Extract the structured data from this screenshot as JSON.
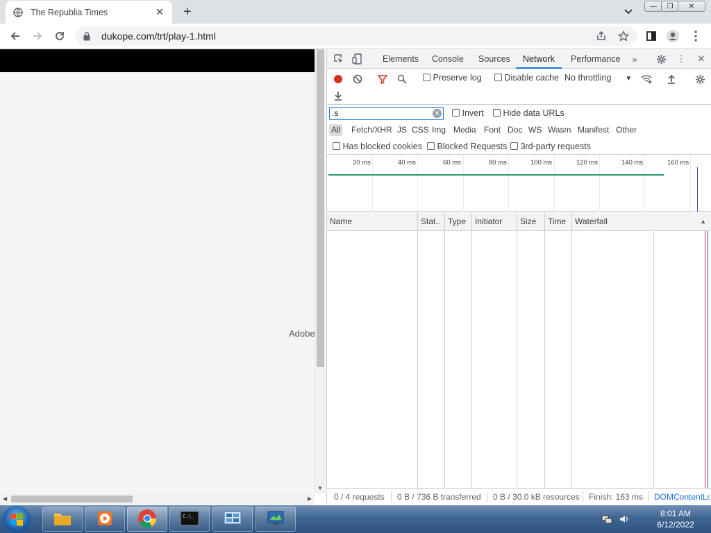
{
  "browser": {
    "tab_title": "The Republia Times",
    "url": "dukope.com/trt/play-1.html"
  },
  "page": {
    "adobe_text": "Adobe"
  },
  "devtools": {
    "tabs": [
      "Elements",
      "Console",
      "Sources",
      "Network",
      "Performance"
    ],
    "active_tab": "Network",
    "toolbar": {
      "preserve_log": "Preserve log",
      "disable_cache": "Disable cache",
      "throttling": "No throttling"
    },
    "filter": {
      "value": ".s",
      "invert": "Invert",
      "hide_data_urls": "Hide data URLs"
    },
    "types": [
      "All",
      "Fetch/XHR",
      "JS",
      "CSS",
      "Img",
      "Media",
      "Font",
      "Doc",
      "WS",
      "Wasm",
      "Manifest",
      "Other"
    ],
    "active_type": "All",
    "blocked": {
      "has_blocked_cookies": "Has blocked cookies",
      "blocked_requests": "Blocked Requests",
      "third_party": "3rd-party requests"
    },
    "overview_ticks": [
      "20 ms",
      "40 ms",
      "60 ms",
      "80 ms",
      "100 ms",
      "120 ms",
      "140 ms",
      "160 ms"
    ],
    "columns": [
      "Name",
      "Stat..",
      "Type",
      "Initiator",
      "Size",
      "Time",
      "Waterfall"
    ],
    "status": {
      "requests": "0 / 4 requests",
      "transferred": "0 B / 736 B transferred",
      "resources": "0 B / 30.0 kB resources",
      "finish": "Finish: 163 ms",
      "domcontent": "DOMContentLo"
    }
  },
  "taskbar": {
    "time": "8:01 AM",
    "date": "6/12/2022"
  },
  "colors": {
    "accent": "#1a73e8",
    "record_red": "#d93025",
    "timeline_green": "#21a366"
  }
}
